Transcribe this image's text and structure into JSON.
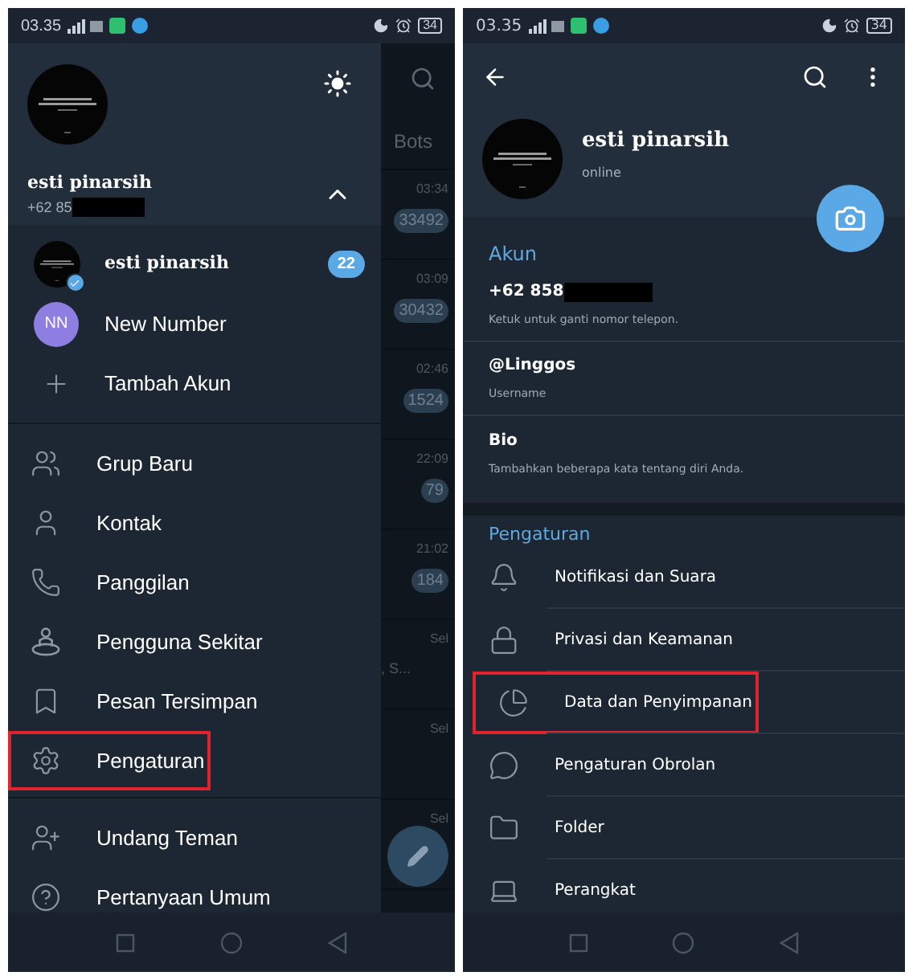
{
  "left_screen": {
    "status_bar": {
      "time": "03.35",
      "battery": "34"
    },
    "chat_list": {
      "tab": "Bots",
      "rows": [
        {
          "time": "03:34",
          "badge": "33492"
        },
        {
          "time": "03:09",
          "badge": "30432"
        },
        {
          "time": "02:46",
          "badge": "1524"
        },
        {
          "time": "22:09",
          "badge": "79"
        },
        {
          "time": "21:02",
          "badge": "184"
        },
        {
          "time": "Sel",
          "preview": ", S..."
        },
        {
          "time": "Sel"
        },
        {
          "time": "Sel"
        }
      ]
    },
    "drawer": {
      "profile": {
        "name": "esti pinarsih",
        "phone": "+62 85",
        "redacted": true
      },
      "accounts": [
        {
          "name": "esti pinarsih",
          "badge": "22"
        },
        {
          "kind": "initials",
          "initials": "NN",
          "name": "New Number"
        },
        {
          "kind": "add",
          "name": "Tambah Akun"
        }
      ],
      "menu": [
        {
          "kind": "group",
          "label": "Grup Baru",
          "highlighted": false
        },
        {
          "kind": "contact",
          "label": "Kontak",
          "highlighted": false
        },
        {
          "kind": "call",
          "label": "Panggilan",
          "highlighted": false
        },
        {
          "kind": "nearby",
          "label": "Pengguna Sekitar",
          "highlighted": false
        },
        {
          "kind": "saved",
          "label": "Pesan Tersimpan",
          "highlighted": false
        },
        {
          "kind": "settings",
          "label": "Pengaturan",
          "highlighted": true
        }
      ],
      "menu_2": [
        {
          "kind": "invite",
          "label": "Undang Teman",
          "highlighted": false
        },
        {
          "kind": "help",
          "label": "Pertanyaan Umum",
          "highlighted": false
        }
      ]
    }
  },
  "right_screen": {
    "status_bar": {
      "time": "03.35",
      "battery": "34"
    },
    "profile": {
      "name": "esti pinarsih",
      "status": "online"
    },
    "account": {
      "title": "Akun",
      "fields": [
        {
          "value": "+62 858",
          "redacted": true,
          "hint": "Ketuk untuk ganti nomor telepon."
        },
        {
          "value": "@Linggos",
          "redacted": false,
          "hint": "Username"
        },
        {
          "value": "Bio",
          "redacted": false,
          "hint": "Tambahkan beberapa kata tentang diri Anda."
        }
      ]
    },
    "settings": {
      "title": "Pengaturan",
      "items": [
        {
          "kind": "bell",
          "label": "Notifikasi dan Suara",
          "highlighted": false
        },
        {
          "kind": "lock",
          "label": "Privasi dan Keamanan",
          "highlighted": false
        },
        {
          "kind": "data",
          "label": "Data dan Penyimpanan",
          "highlighted": true
        },
        {
          "kind": "chat",
          "label": "Pengaturan Obrolan",
          "highlighted": false
        },
        {
          "kind": "folder",
          "label": "Folder",
          "highlighted": false
        },
        {
          "kind": "devices",
          "label": "Perangkat",
          "highlighted": false
        }
      ]
    }
  }
}
